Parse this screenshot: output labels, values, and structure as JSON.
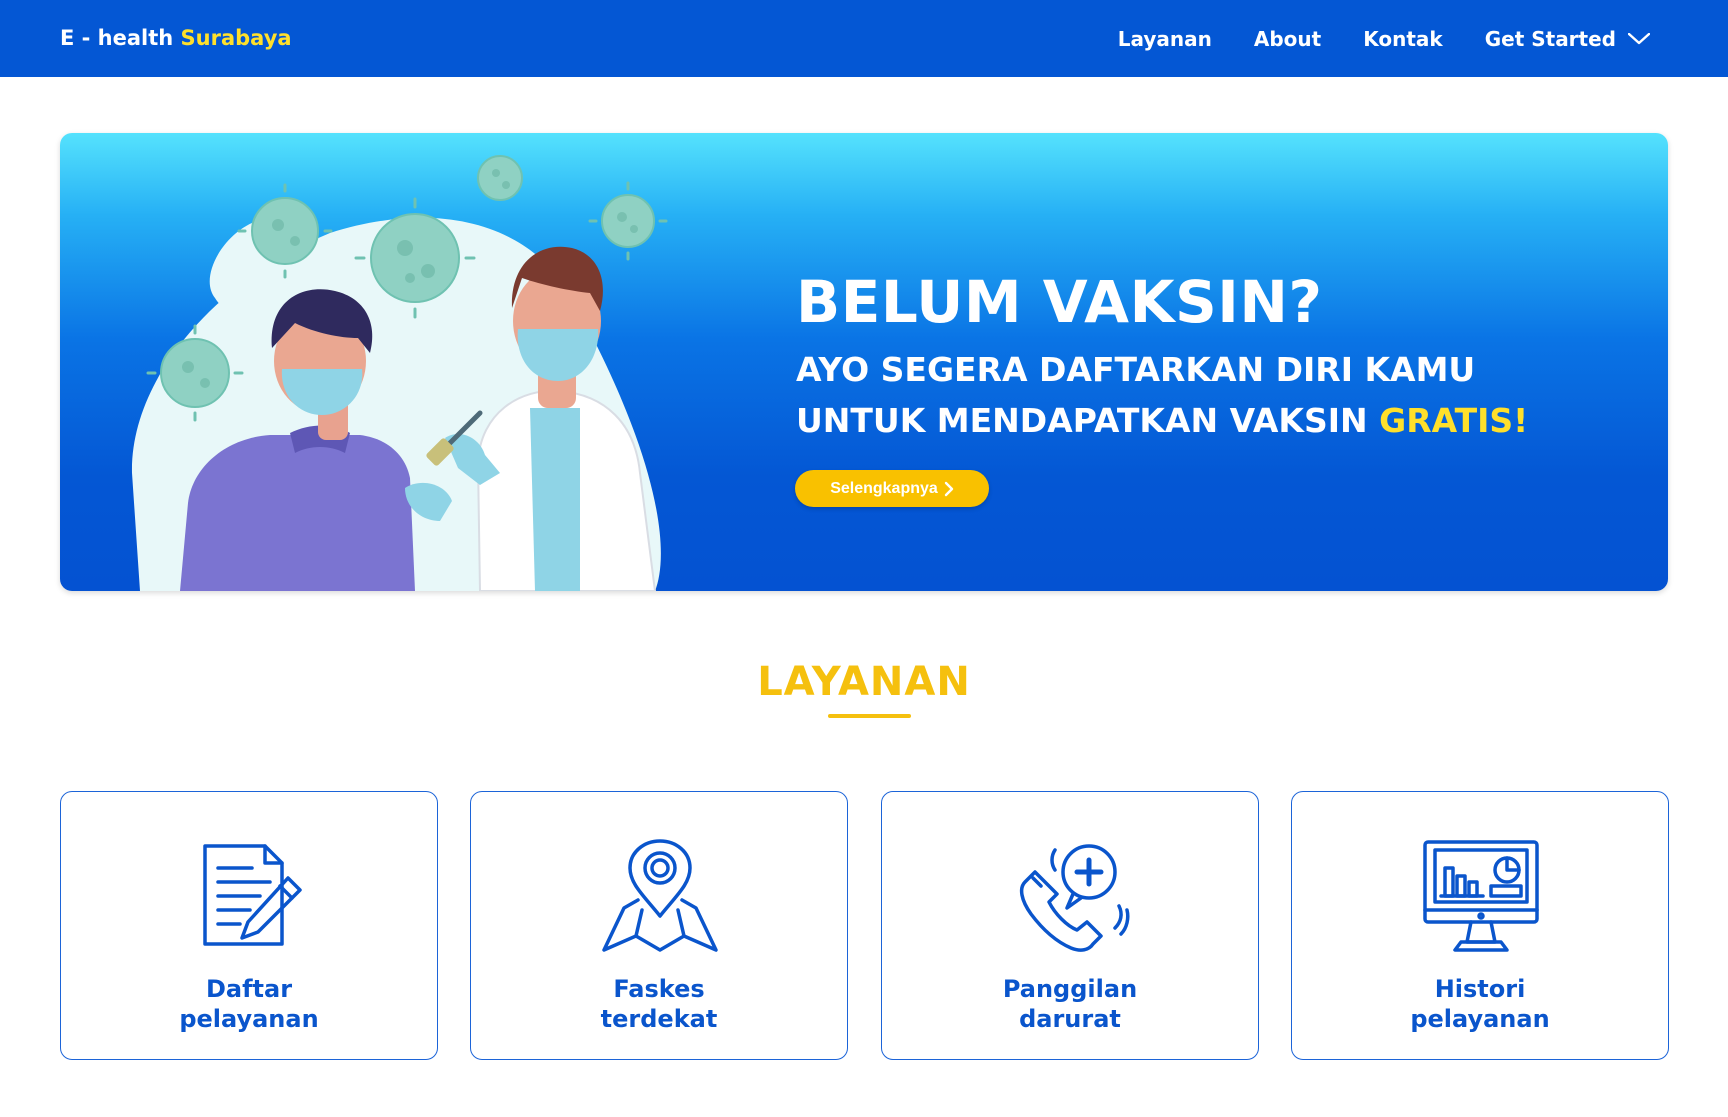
{
  "brand": {
    "name": "E - health",
    "city": "Surabaya"
  },
  "nav": {
    "items": [
      {
        "label": "Layanan"
      },
      {
        "label": "About"
      },
      {
        "label": "Kontak"
      },
      {
        "label": "Get Started"
      }
    ],
    "dropdown_icon": "chevron-down-icon"
  },
  "hero": {
    "title": "BELUM VAKSIN?",
    "subtitle_line1": "AYO SEGERA DAFTARKAN DIRI KAMU",
    "subtitle_line2": "UNTUK MENDAPATKAN VAKSIN",
    "subtitle_highlight": "GRATIS!",
    "button_label": "Selengkapnya",
    "button_icon": "chevron-right-icon"
  },
  "services": {
    "title": "LAYANAN",
    "cards": [
      {
        "line1": "Daftar",
        "line2": "pelayanan",
        "icon": "form-pencil-icon"
      },
      {
        "line1": "Faskes",
        "line2": "terdekat",
        "icon": "map-pin-icon"
      },
      {
        "line1": "Panggilan",
        "line2": "darurat",
        "icon": "emergency-call-icon"
      },
      {
        "line1": "Histori",
        "line2": "pelayanan",
        "icon": "monitor-chart-icon"
      }
    ]
  },
  "colors": {
    "primary": "#0457d4",
    "accent": "#ffe02b",
    "button": "#f9c100",
    "section_title": "#f5c00e"
  }
}
